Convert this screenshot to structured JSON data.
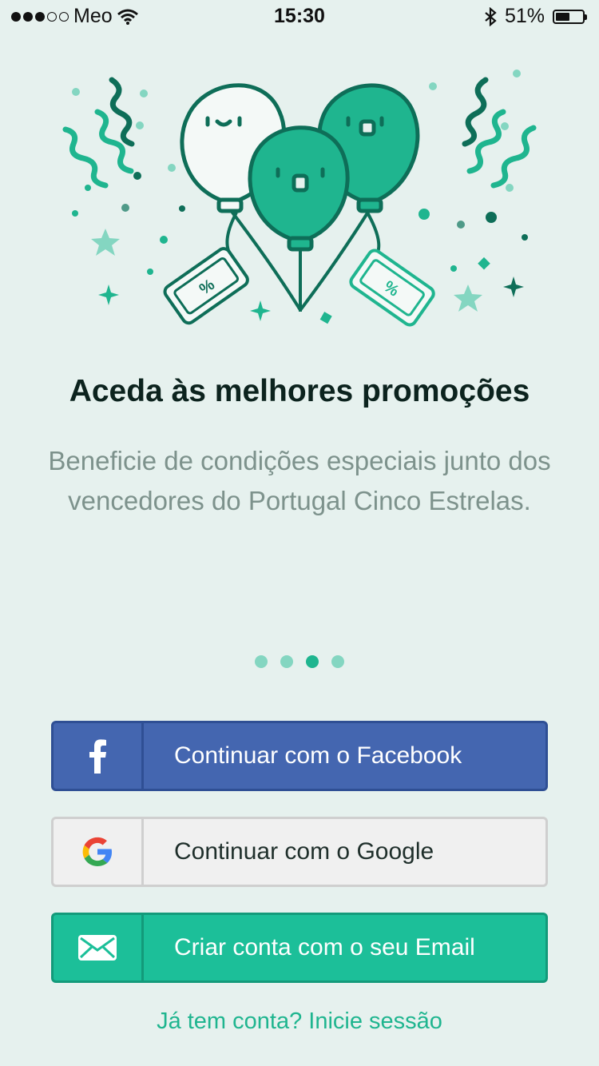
{
  "status_bar": {
    "carrier": "Meo",
    "time": "15:30",
    "battery_percent": "51%",
    "battery_level": 0.51,
    "signal_bars_filled": 3,
    "signal_bars_total": 5
  },
  "onboarding": {
    "title": "Aceda às melhores promoções",
    "description": "Beneficie de condições especiais junto dos vencedores do Portugal Cinco Estrelas.",
    "page_count": 4,
    "active_page": 3
  },
  "buttons": {
    "facebook": {
      "label": "Continuar com o Facebook",
      "icon": "facebook-icon"
    },
    "google": {
      "label": "Continuar com o Google",
      "icon": "google-icon"
    },
    "email": {
      "label": "Criar conta com o seu Email",
      "icon": "mail-icon"
    }
  },
  "login_link": "Já tem conta? Inicie sessão",
  "colors": {
    "background": "#e6f1ee",
    "accent": "#1fb58f",
    "facebook": "#4466b0",
    "email": "#1cbf99",
    "headline": "#0c231e",
    "body_text": "#7d928c"
  }
}
